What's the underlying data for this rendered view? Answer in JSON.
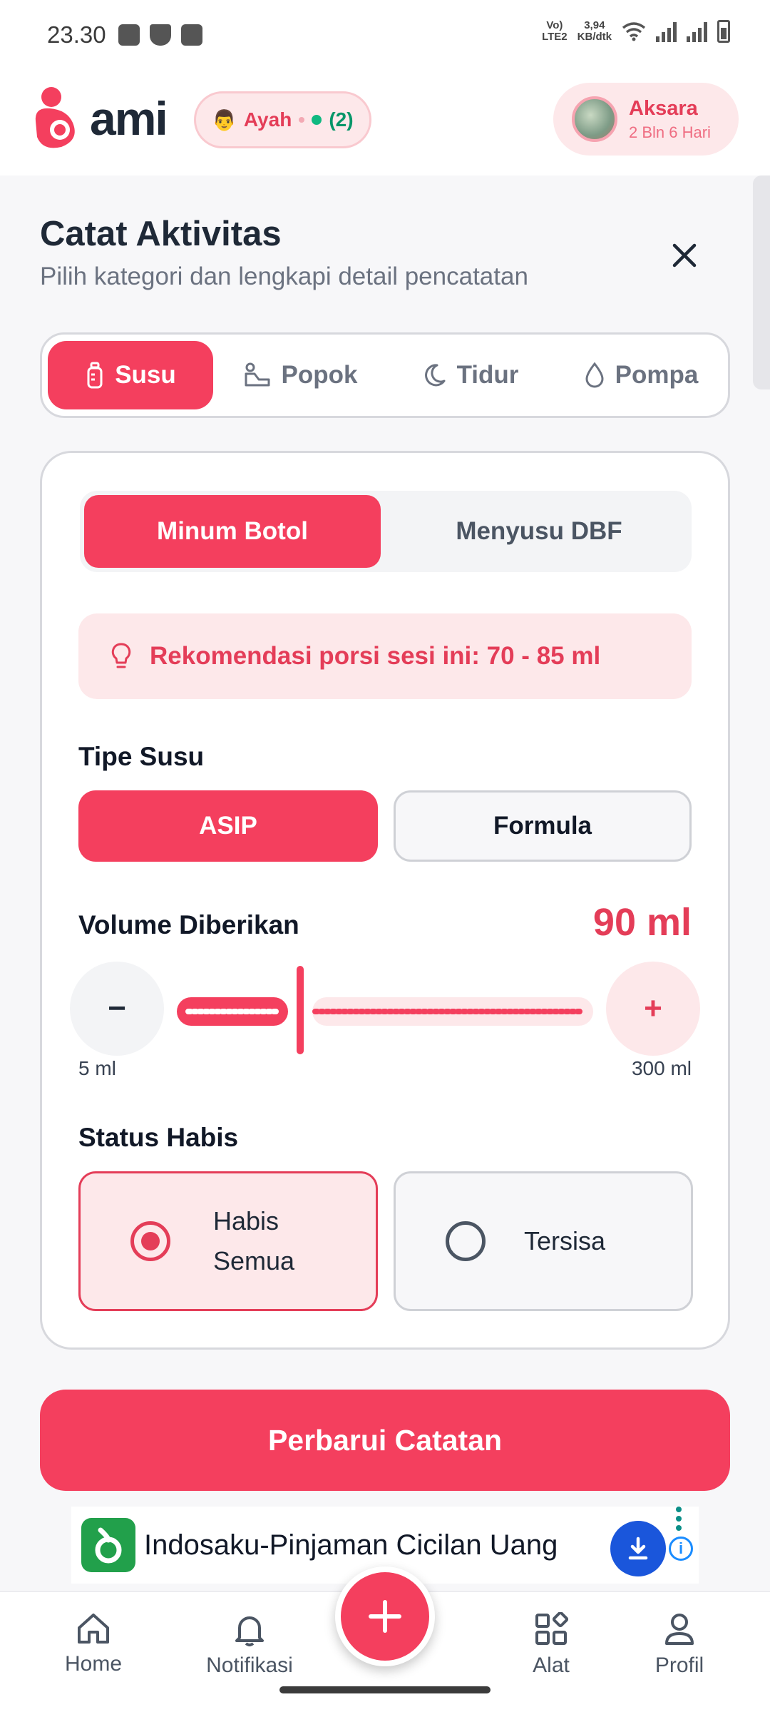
{
  "status_bar": {
    "time": "23.30",
    "network_top": "Vo)",
    "network_bottom": "LTE2",
    "speed_value": "3,94",
    "speed_unit": "KB/dtk"
  },
  "header": {
    "logo_text": "ami",
    "role_emoji": "👨",
    "role_label": "Ayah",
    "online_count": "(2)",
    "child_name": "Aksara",
    "child_age": "2 Bln 6 Hari"
  },
  "sheet": {
    "title": "Catat Aktivitas",
    "subtitle": "Pilih kategori dan lengkapi detail pencatatan",
    "tabs": [
      {
        "label": "Susu",
        "icon": "bottle-icon",
        "active": true
      },
      {
        "label": "Popok",
        "icon": "diaper-icon",
        "active": false
      },
      {
        "label": "Tidur",
        "icon": "moon-icon",
        "active": false
      },
      {
        "label": "Pompa",
        "icon": "drop-icon",
        "active": false
      }
    ],
    "feed_mode": {
      "options": [
        "Minum Botol",
        "Menyusu DBF"
      ],
      "selected": "Minum Botol"
    },
    "recommendation": "Rekomendasi porsi sesi ini: 70 - 85 ml",
    "milk_type": {
      "label": "Tipe Susu",
      "options": [
        "ASIP",
        "Formula"
      ],
      "selected": "ASIP"
    },
    "volume": {
      "label": "Volume Diberikan",
      "value_text": "90 ml",
      "value": 90,
      "min": 5,
      "max": 300,
      "min_label": "5 ml",
      "max_label": "300 ml",
      "minus_label": "−",
      "plus_label": "+"
    },
    "status": {
      "label": "Status Habis",
      "options": [
        "Habis Semua",
        "Tersisa"
      ],
      "selected": "Habis Semua"
    },
    "submit_label": "Perbarui Catatan"
  },
  "ad": {
    "title": "Indosaku-Pinjaman Cicilan Uang"
  },
  "bottom_nav": [
    {
      "label": "Home",
      "icon": "home-icon"
    },
    {
      "label": "Notifikasi",
      "icon": "bell-icon"
    },
    {
      "label": "Alat",
      "icon": "grid-icon"
    },
    {
      "label": "Profil",
      "icon": "user-icon"
    }
  ],
  "colors": {
    "primary": "#f43f5e",
    "primary_text": "#e43d58",
    "pink_bg": "#fde8ea",
    "online": "#10b981"
  }
}
